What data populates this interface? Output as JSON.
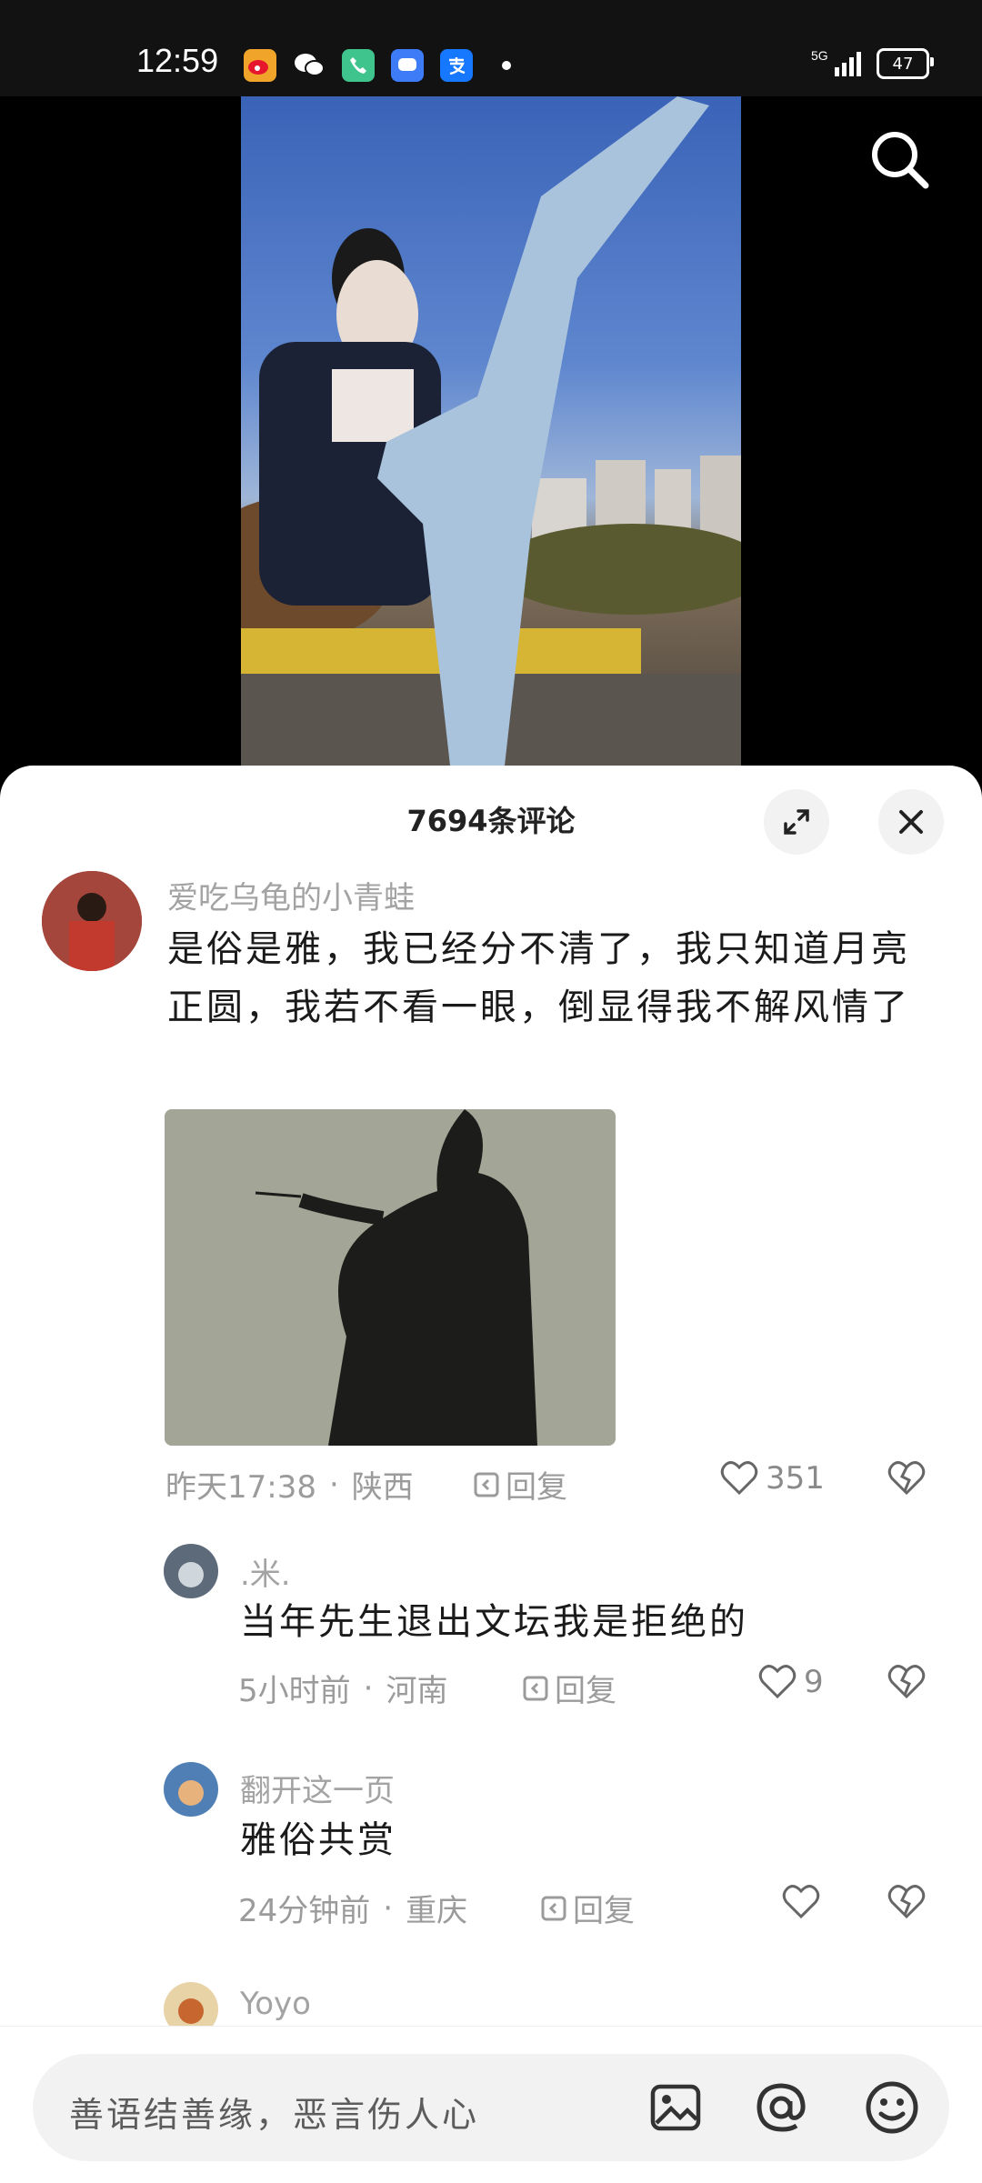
{
  "status_bar": {
    "time": "12:59",
    "signal": "5G",
    "battery": "47"
  },
  "comments_header": {
    "title": "7694条评论"
  },
  "comments": [
    {
      "username": "爱吃乌龟的小青蛙",
      "text": "是俗是雅，我已经分不清了，我只知道月亮正圆，我若不看一眼，倒显得我不解风情了",
      "time": "昨天17:38",
      "location": "陕西",
      "reply": "回复",
      "likes": "351"
    },
    {
      "username": ".米.",
      "text": "当年先生退出文坛我是拒绝的",
      "time": "5小时前",
      "location": "河南",
      "reply": "回复",
      "likes": "9"
    },
    {
      "username": "翻开这一页",
      "text": "雅俗共赏",
      "time": "24分钟前",
      "location": "重庆",
      "reply": "回复",
      "likes": ""
    },
    {
      "username": "Yoyo"
    }
  ],
  "input_bar": {
    "placeholder": "善语结善缘，恶言伤人心"
  },
  "icons": {
    "search": "search-icon",
    "expand": "expand-icon",
    "close": "close-icon",
    "reply": "reply-icon",
    "like": "heart-icon",
    "dislike": "broken-heart-icon",
    "image": "image-icon",
    "mention": "at-icon",
    "emoji": "emoji-icon"
  }
}
